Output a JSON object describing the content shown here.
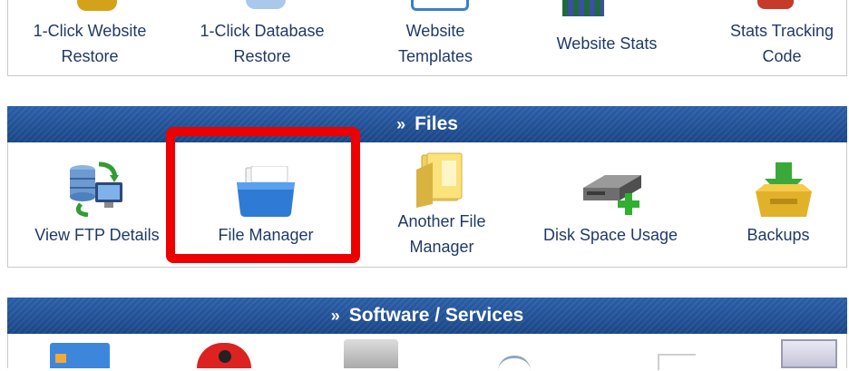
{
  "top_items": [
    {
      "line1": "1-Click Website",
      "line2": "Restore"
    },
    {
      "line1": "1-Click Database",
      "line2": "Restore"
    },
    {
      "line1": "Website",
      "line2": "Templates"
    },
    {
      "line1": "Website Stats",
      "line2": ""
    },
    {
      "line1": "Stats Tracking",
      "line2": "Code"
    }
  ],
  "files_section": {
    "raquo": "»",
    "title": "Files",
    "items": [
      {
        "line1": "View FTP Details",
        "line2": "",
        "icon": "ftp-server-icon"
      },
      {
        "line1": "File Manager",
        "line2": "",
        "icon": "file-manager-folder-icon"
      },
      {
        "line1": "Another File",
        "line2": "Manager",
        "icon": "folder-icon"
      },
      {
        "line1": "Disk Space Usage",
        "line2": "",
        "icon": "hard-drive-icon"
      },
      {
        "line1": "Backups",
        "line2": "",
        "icon": "backup-tray-icon"
      }
    ]
  },
  "software_section": {
    "raquo": "»",
    "title": "Software / Services"
  },
  "colors": {
    "header_blue": "#1f4f94",
    "link_text": "#1f3a68",
    "highlight_red": "#ee0000"
  }
}
